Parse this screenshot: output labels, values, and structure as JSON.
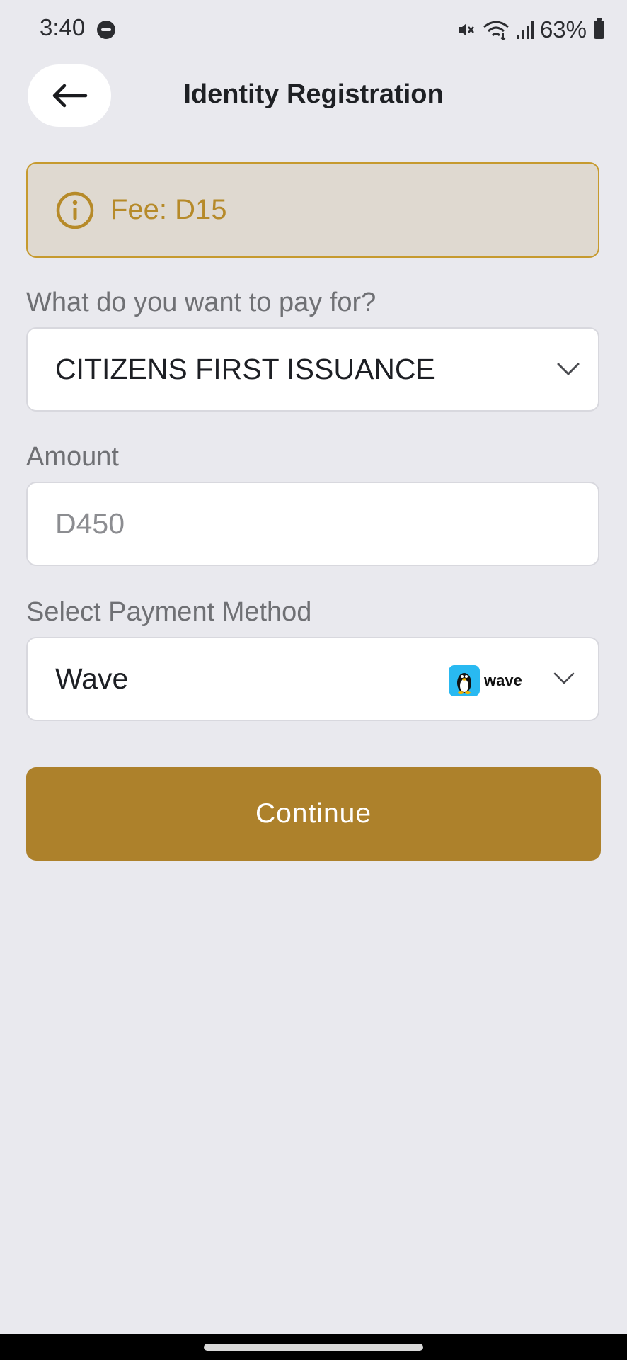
{
  "status_bar": {
    "time": "3:40",
    "battery": "63%",
    "icons": [
      "do-not-disturb-icon",
      "mute-icon",
      "wifi-icon",
      "signal-icon",
      "battery-icon"
    ]
  },
  "header": {
    "title": "Identity Registration",
    "back_icon": "arrow-left-icon"
  },
  "fee_banner": {
    "text": "Fee: D15",
    "icon": "info-icon"
  },
  "form": {
    "pay_for_label": "What do you want to pay for?",
    "pay_for_value": "CITIZENS FIRST ISSUANCE",
    "amount_label": "Amount",
    "amount_placeholder": "D450",
    "payment_label": "Select Payment Method",
    "payment_value": "Wave",
    "payment_logo_text": "wave"
  },
  "continue_label": "Continue",
  "colors": {
    "accent": "#ad812b",
    "fee_text": "#b68a29",
    "fee_background": "#dfd9d0",
    "background": "#e9e9ee",
    "wave_blue": "#29b9f1"
  }
}
